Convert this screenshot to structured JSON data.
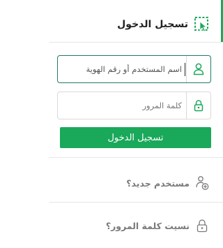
{
  "header": {
    "title": "تسجيل الدخول",
    "icon": "cursor-select-icon"
  },
  "login_form": {
    "username": {
      "placeholder": "اسم المستخدم أو رقم الهوية",
      "value": "",
      "icon": "user-icon"
    },
    "password": {
      "placeholder": "كلمة المرور",
      "value": "",
      "icon": "lock-icon"
    },
    "submit_label": "تسجيل الدخول"
  },
  "links": {
    "new_user": {
      "label": "مستخدم جديد؟",
      "icon": "add-user-icon"
    },
    "forgot_password": {
      "label": "نسيت كلمة المرور؟",
      "icon": "lock-icon"
    }
  },
  "colors": {
    "accent": "#1aa85a",
    "focus_border": "#1f7a68",
    "border": "#d9d9d9",
    "muted_text": "#7a7a7a"
  }
}
